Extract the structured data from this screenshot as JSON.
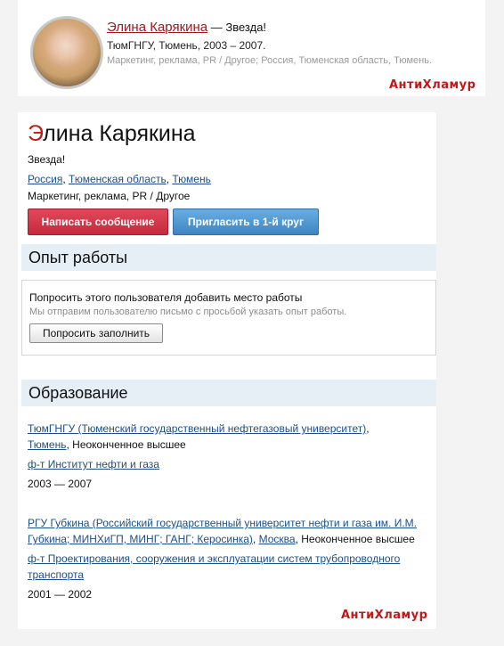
{
  "top_card": {
    "name": "Элина Карякина",
    "status": " — Звезда!",
    "line2": "ТюмГНГУ, Тюмень, 2003 – 2007.",
    "line3": "Маркетинг, реклама, PR / Другое; Россия, Тюменская область, Тюмень."
  },
  "watermark": "АнтиХламур",
  "profile": {
    "name_first_letter": "Э",
    "name_rest": "лина Карякина",
    "status": "Звезда!",
    "location": {
      "country": "Россия",
      "region": "Тюменская область",
      "city": "Тюмень",
      "sep1": ", ",
      "sep2": ", "
    },
    "profession": "Маркетинг, реклама, PR / Другое",
    "send_message_label": "Написать сообщение",
    "invite_label": "Пригласить в 1-й круг"
  },
  "work": {
    "title": "Опыт работы",
    "request_text": "Попросить этого пользователя добавить место работы",
    "request_sub": "Мы отправим пользователю письмо с просьбой указать опыт работы.",
    "button_label": "Попросить заполнить"
  },
  "education": {
    "title": "Образование",
    "items": [
      {
        "university": "ТюмГНГУ (Тюменский государственный нефтегазовый университет)",
        "after_uni": ",",
        "city": "Тюмень",
        "degree": ", Неоконченное высшее",
        "faculty": "ф-т Институт нефти и газа",
        "years": "2003 — 2007"
      },
      {
        "university": "РГУ Губкина (Российский государственный университет нефти и газа им. И.М. Губкина; МИНХиГП, МИНГ; ГАНГ; Керосинка)",
        "after_uni": ", ",
        "city": "Москва",
        "degree": ", Неоконченное высшее",
        "faculty": "ф-т Проектирования, сооружения и эксплуатации систем трубопроводного транспорта",
        "years": "2001 — 2002"
      }
    ]
  }
}
